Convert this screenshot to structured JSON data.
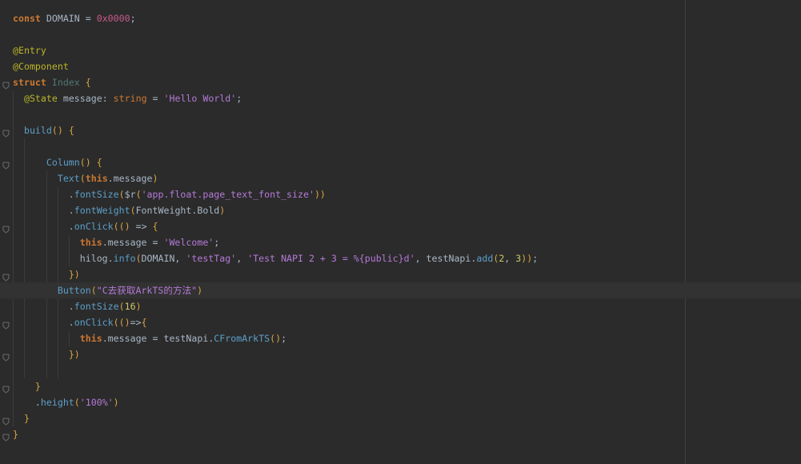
{
  "editor": {
    "lines": [
      {
        "tokens": [
          {
            "t": "const",
            "c": "tok-const"
          },
          {
            "t": " DOMAIN ",
            "c": "cls"
          },
          {
            "t": "=",
            "c": "punc"
          },
          {
            "t": " ",
            "c": "cls"
          },
          {
            "t": "0x0000",
            "c": "tok-hex"
          },
          {
            "t": ";",
            "c": "punc"
          }
        ]
      },
      {
        "tokens": []
      },
      {
        "tokens": [
          {
            "t": "@Entry",
            "c": "tok-dec2"
          }
        ]
      },
      {
        "tokens": [
          {
            "t": "@Component",
            "c": "tok-dec2"
          }
        ]
      },
      {
        "tokens": [
          {
            "t": "struct",
            "c": "tok-const"
          },
          {
            "t": " ",
            "c": "cls"
          },
          {
            "t": "Index",
            "c": "struct-name"
          },
          {
            "t": " ",
            "c": "cls"
          },
          {
            "t": "{",
            "c": "tok-bracket"
          }
        ],
        "fold": true
      },
      {
        "tokens": [
          {
            "t": "  ",
            "c": "cls"
          },
          {
            "t": "@State",
            "c": "tok-dec2"
          },
          {
            "t": " message: ",
            "c": "cls"
          },
          {
            "t": "string",
            "c": "tok-builtin"
          },
          {
            "t": " = ",
            "c": "cls"
          },
          {
            "t": "'Hello World'",
            "c": "tok-str2"
          },
          {
            "t": ";",
            "c": "punc"
          }
        ]
      },
      {
        "tokens": []
      },
      {
        "tokens": [
          {
            "t": "  ",
            "c": "cls"
          },
          {
            "t": "build",
            "c": "tok-fun"
          },
          {
            "t": "()",
            "c": "tok-bracket"
          },
          {
            "t": " ",
            "c": "cls"
          },
          {
            "t": "{",
            "c": "tok-bracket"
          }
        ],
        "fold": true
      },
      {
        "tokens": []
      },
      {
        "tokens": [
          {
            "t": "      ",
            "c": "cls"
          },
          {
            "t": "Column",
            "c": "tok-fun"
          },
          {
            "t": "()",
            "c": "tok-bracket"
          },
          {
            "t": " ",
            "c": "cls"
          },
          {
            "t": "{",
            "c": "tok-bracket"
          }
        ],
        "fold": true
      },
      {
        "tokens": [
          {
            "t": "        ",
            "c": "cls"
          },
          {
            "t": "Text",
            "c": "tok-fun"
          },
          {
            "t": "(",
            "c": "tok-bracket"
          },
          {
            "t": "this",
            "c": "this"
          },
          {
            "t": ".message",
            "c": "cls"
          },
          {
            "t": ")",
            "c": "tok-bracket"
          }
        ]
      },
      {
        "tokens": [
          {
            "t": "          .",
            "c": "cls"
          },
          {
            "t": "fontSize",
            "c": "tok-fun"
          },
          {
            "t": "(",
            "c": "tok-bracket"
          },
          {
            "t": "$r",
            "c": "cls"
          },
          {
            "t": "(",
            "c": "tok-bracket"
          },
          {
            "t": "'app.float.page_text_font_size'",
            "c": "tok-str2"
          },
          {
            "t": "))",
            "c": "tok-bracket"
          }
        ]
      },
      {
        "tokens": [
          {
            "t": "          .",
            "c": "cls"
          },
          {
            "t": "fontWeight",
            "c": "tok-fun"
          },
          {
            "t": "(",
            "c": "tok-bracket"
          },
          {
            "t": "FontWeight.Bold",
            "c": "cls"
          },
          {
            "t": ")",
            "c": "tok-bracket"
          }
        ]
      },
      {
        "tokens": [
          {
            "t": "          .",
            "c": "cls"
          },
          {
            "t": "onClick",
            "c": "tok-fun"
          },
          {
            "t": "(()",
            "c": "tok-bracket"
          },
          {
            "t": " => ",
            "c": "cls"
          },
          {
            "t": "{",
            "c": "tok-bracket"
          }
        ],
        "fold": true
      },
      {
        "tokens": [
          {
            "t": "            ",
            "c": "cls"
          },
          {
            "t": "this",
            "c": "this"
          },
          {
            "t": ".message = ",
            "c": "cls"
          },
          {
            "t": "'Welcome'",
            "c": "tok-str2"
          },
          {
            "t": ";",
            "c": "punc"
          }
        ]
      },
      {
        "tokens": [
          {
            "t": "            hilog.",
            "c": "cls"
          },
          {
            "t": "info",
            "c": "tok-fun"
          },
          {
            "t": "(",
            "c": "tok-bracket"
          },
          {
            "t": "DOMAIN, ",
            "c": "cls"
          },
          {
            "t": "'testTag'",
            "c": "tok-str2"
          },
          {
            "t": ", ",
            "c": "cls"
          },
          {
            "t": "'Test NAPI 2 + 3 = %{public}d'",
            "c": "tok-str2"
          },
          {
            "t": ", testNapi.",
            "c": "cls"
          },
          {
            "t": "add",
            "c": "tok-fun"
          },
          {
            "t": "(",
            "c": "tok-bracket"
          },
          {
            "t": "2",
            "c": "tok-numlit"
          },
          {
            "t": ", ",
            "c": "cls"
          },
          {
            "t": "3",
            "c": "tok-numlit"
          },
          {
            "t": "))",
            "c": "tok-bracket"
          },
          {
            "t": ";",
            "c": "punc"
          }
        ]
      },
      {
        "tokens": [
          {
            "t": "          ",
            "c": "cls"
          },
          {
            "t": "})",
            "c": "tok-bracket"
          }
        ],
        "fold": true
      },
      {
        "tokens": [
          {
            "t": "        ",
            "c": "cls"
          },
          {
            "t": "Button",
            "c": "tok-fun"
          },
          {
            "t": "(",
            "c": "tok-bracket"
          },
          {
            "t": "\"C去获取ArkTS的方法\"",
            "c": "tok-str2"
          },
          {
            "t": ")",
            "c": "tok-bracket"
          }
        ],
        "current": true
      },
      {
        "tokens": [
          {
            "t": "          .",
            "c": "cls"
          },
          {
            "t": "fontSize",
            "c": "tok-fun"
          },
          {
            "t": "(",
            "c": "tok-bracket"
          },
          {
            "t": "16",
            "c": "tok-numlit"
          },
          {
            "t": ")",
            "c": "tok-bracket"
          }
        ]
      },
      {
        "tokens": [
          {
            "t": "          .",
            "c": "cls"
          },
          {
            "t": "onClick",
            "c": "tok-fun"
          },
          {
            "t": "(()",
            "c": "tok-bracket"
          },
          {
            "t": "=>",
            "c": "cls"
          },
          {
            "t": "{",
            "c": "tok-bracket"
          }
        ],
        "fold": true
      },
      {
        "tokens": [
          {
            "t": "            ",
            "c": "cls"
          },
          {
            "t": "this",
            "c": "this"
          },
          {
            "t": ".message = testNapi.",
            "c": "cls"
          },
          {
            "t": "CFromArkTS",
            "c": "tok-fun"
          },
          {
            "t": "()",
            "c": "tok-bracket"
          },
          {
            "t": ";",
            "c": "punc"
          }
        ]
      },
      {
        "tokens": [
          {
            "t": "          ",
            "c": "cls"
          },
          {
            "t": "})",
            "c": "tok-bracket"
          }
        ],
        "fold": true
      },
      {
        "tokens": []
      },
      {
        "tokens": [
          {
            "t": "    ",
            "c": "cls"
          },
          {
            "t": "}",
            "c": "tok-bracket"
          }
        ],
        "fold": true
      },
      {
        "tokens": [
          {
            "t": "    .",
            "c": "cls"
          },
          {
            "t": "height",
            "c": "tok-fun"
          },
          {
            "t": "(",
            "c": "tok-bracket"
          },
          {
            "t": "'100%'",
            "c": "tok-str2"
          },
          {
            "t": ")",
            "c": "tok-bracket"
          }
        ]
      },
      {
        "tokens": [
          {
            "t": "  ",
            "c": "cls"
          },
          {
            "t": "}",
            "c": "tok-bracket"
          }
        ],
        "fold": true
      },
      {
        "tokens": [
          {
            "t": "}",
            "c": "tok-bracket"
          }
        ],
        "fold": true
      }
    ]
  }
}
